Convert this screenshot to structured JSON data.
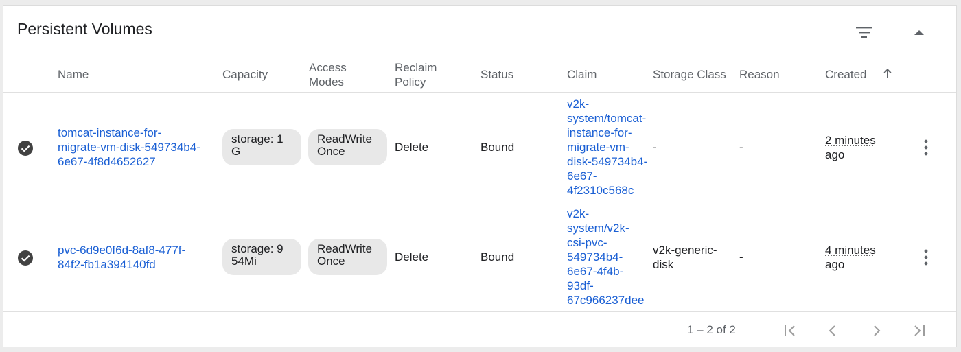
{
  "panel": {
    "title": "Persistent Volumes",
    "icons": {
      "filter": "filter-icon",
      "collapse": "chevron-up-icon"
    }
  },
  "table": {
    "columns": {
      "name": "Name",
      "capacity": "Capacity",
      "access_modes_1": "Access",
      "access_modes_2": "Modes",
      "reclaim_policy_1": "Reclaim",
      "reclaim_policy_2": "Policy",
      "status": "Status",
      "claim": "Claim",
      "storage_class": "Storage Class",
      "reason": "Reason",
      "created": "Created",
      "sort_icon": "arrow-up-icon"
    },
    "rows": [
      {
        "status_icon": "check-circle-icon",
        "name_1": "tomcat-instance-for-",
        "name_2": "migrate-vm-disk-549734b4-",
        "name_3": "6e67-4f8d4652627",
        "capacity_1": "storage: 1",
        "capacity_2": "G",
        "access_1": "ReadWrite",
        "access_2": "Once",
        "reclaim": "Delete",
        "status": "Bound",
        "claim_lines": [
          "v2k-",
          "system/tomcat-",
          "instance-for-",
          "migrate-vm-",
          "disk-549734b4-",
          "6e67-",
          "4f2310c568c"
        ],
        "storage_class_1": "-",
        "storage_class_2": "",
        "reason": "-",
        "created_1": "2 minutes",
        "created_2": "ago"
      },
      {
        "status_icon": "check-circle-icon",
        "name_1": "pvc-6d9e0f6d-8af8-477f-",
        "name_2": "84f2-fb1a394140fd",
        "name_3": "",
        "capacity_1": "storage: 9",
        "capacity_2": "54Mi",
        "access_1": "ReadWrite",
        "access_2": "Once",
        "reclaim": "Delete",
        "status": "Bound",
        "claim_lines": [
          "v2k-",
          "system/v2k-",
          "csi-pvc-",
          "549734b4-",
          "6e67-4f4b-",
          "93df-",
          "67c966237dee"
        ],
        "storage_class_1": "v2k-generic-",
        "storage_class_2": "disk",
        "reason": "-",
        "created_1": "4 minutes",
        "created_2": "ago"
      }
    ]
  },
  "paginator": {
    "range_label": "1 – 2 of 2",
    "icons": {
      "first": "first-page-icon",
      "prev": "chevron-left-icon",
      "next": "chevron-right-icon",
      "last": "last-page-icon"
    }
  }
}
